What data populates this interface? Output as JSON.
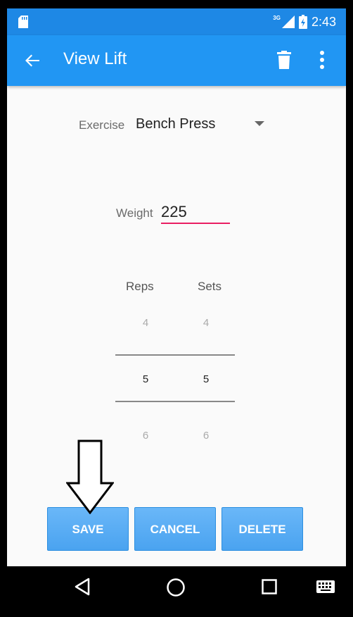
{
  "status_bar": {
    "time": "2:43",
    "network": "3G",
    "icons": [
      "sd-card-icon",
      "signal-icon",
      "battery-charging-icon"
    ]
  },
  "app_bar": {
    "title": "View Lift",
    "icons": [
      "back-arrow-icon",
      "trash-icon",
      "more-vert-icon"
    ]
  },
  "form": {
    "exercise_label": "Exercise",
    "exercise_value": "Bench Press",
    "weight_label": "Weight",
    "weight_value": "225"
  },
  "pickers": {
    "reps_label": "Reps",
    "sets_label": "Sets",
    "reps": {
      "prev": "4",
      "current": "5",
      "next": "6"
    },
    "sets": {
      "prev": "4",
      "current": "5",
      "next": "6"
    }
  },
  "buttons": {
    "save": "SAVE",
    "cancel": "CANCEL",
    "delete": "DELETE"
  },
  "annotation": {
    "icon": "down-arrow-pointer-icon"
  },
  "nav_bar": {
    "icons": [
      "nav-back-icon",
      "nav-home-icon",
      "nav-recents-icon",
      "keyboard-icon"
    ]
  },
  "colors": {
    "status_bar": "#1e88e5",
    "app_bar": "#2196f3",
    "button": "#4aa3f0",
    "underline_accent": "#e91e63"
  }
}
